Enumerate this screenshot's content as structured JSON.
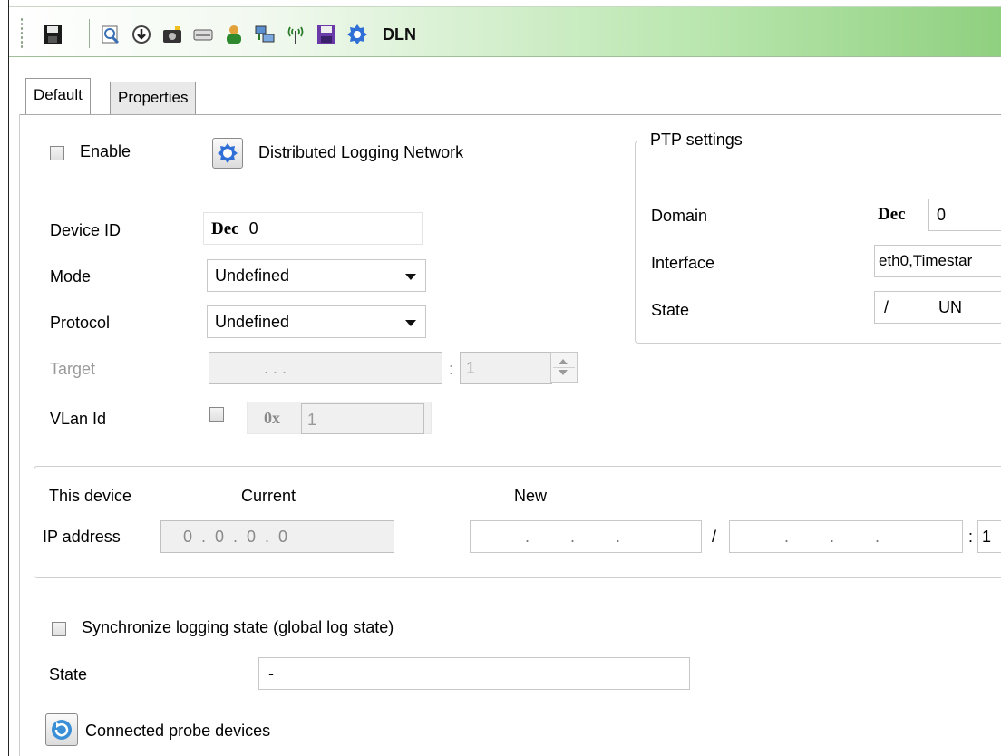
{
  "toolbar": {
    "title": "DLN",
    "icons": [
      "save-icon",
      "preview-icon",
      "download-icon",
      "camera-icon",
      "card-icon",
      "user-icon",
      "network-icon",
      "antenna-icon",
      "floppy-icon",
      "gear-icon"
    ]
  },
  "tabs": [
    {
      "label": "Default",
      "active": true
    },
    {
      "label": "Properties",
      "active": false
    }
  ],
  "general": {
    "enable_label": "Enable",
    "dln_label": "Distributed Logging Network",
    "device_id_label": "Device ID",
    "device_id_format": "Dec",
    "device_id_value": "0",
    "mode_label": "Mode",
    "mode_value": "Undefined",
    "protocol_label": "Protocol",
    "protocol_value": "Undefined",
    "target_label": "Target",
    "target_ip": ".        .        .",
    "target_sep": ":",
    "target_port": "1",
    "vlan_label": "VLan Id",
    "vlan_format": "0x",
    "vlan_value": "1"
  },
  "ptp": {
    "legend": "PTP settings",
    "domain_label": "Domain",
    "domain_format": "Dec",
    "domain_value": "0",
    "interface_label": "Interface",
    "interface_value": "eth0,Timestar",
    "state_label": "State",
    "state_value": "/           UN"
  },
  "device": {
    "this_device_label": "This device",
    "current_label": "Current",
    "new_label": "New",
    "ip_label": "IP address",
    "current_ip": "0  .  0  .  0  .  0",
    "new_ip": ".         .         .",
    "slash": "/",
    "new_mask": ".         .         .",
    "port_sep": ":",
    "port_value": "1"
  },
  "sync": {
    "label": "Synchronize logging state (global log state)",
    "state_label": "State",
    "state_value": "-",
    "probe_label": "Connected probe devices"
  },
  "colors": {
    "toolbar_gradient_end": "#8fd07f",
    "accent_blue": "#2f6fd6"
  }
}
